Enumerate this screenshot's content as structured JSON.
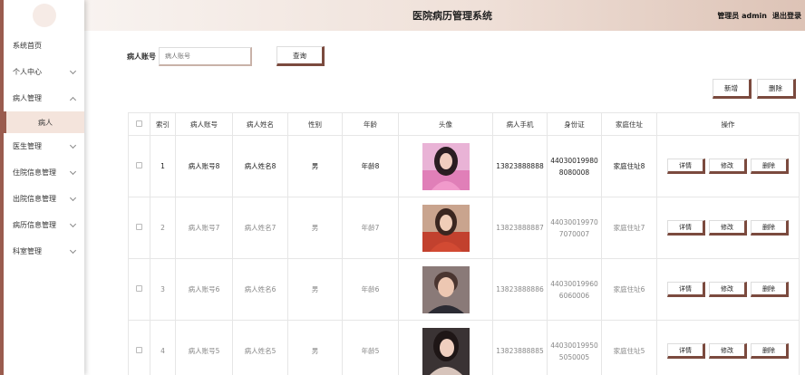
{
  "header": {
    "title": "医院病历管理系统",
    "admin": "管理员 admin",
    "logout": "退出登录"
  },
  "sidebar": {
    "items": [
      {
        "label": "系统首页",
        "chevron": false
      },
      {
        "label": "个人中心",
        "chevron": "down"
      },
      {
        "label": "病人管理",
        "chevron": "up"
      },
      {
        "label": "医生管理",
        "chevron": "down"
      },
      {
        "label": "住院信息管理",
        "chevron": "down"
      },
      {
        "label": "出院信息管理",
        "chevron": "down"
      },
      {
        "label": "病历信息管理",
        "chevron": "down"
      },
      {
        "label": "科室管理",
        "chevron": "down"
      }
    ],
    "sub_item": "病人"
  },
  "search": {
    "label": "病人账号",
    "placeholder": "病人账号",
    "query_label": "查询"
  },
  "actions": {
    "add_label": "新增",
    "delete_label": "删除"
  },
  "table": {
    "headers": [
      "索引",
      "病人账号",
      "病人姓名",
      "性别",
      "年龄",
      "头像",
      "病人手机",
      "身份证",
      "家庭住址",
      "操作"
    ],
    "op_labels": {
      "detail": "详情",
      "edit": "修改",
      "delete": "删除"
    },
    "rows": [
      {
        "index": "1",
        "account": "病人账号8",
        "name": "病人姓名8",
        "gender": "男",
        "age": "年龄8",
        "phone": "13823888888",
        "id_line1": "44030019980",
        "id_line2": "8080008",
        "address": "家庭住址8"
      },
      {
        "index": "2",
        "account": "病人账号7",
        "name": "病人姓名7",
        "gender": "男",
        "age": "年龄7",
        "phone": "13823888887",
        "id_line1": "44030019970",
        "id_line2": "7070007",
        "address": "家庭住址7"
      },
      {
        "index": "3",
        "account": "病人账号6",
        "name": "病人姓名6",
        "gender": "男",
        "age": "年龄6",
        "phone": "13823888886",
        "id_line1": "44030019960",
        "id_line2": "6060006",
        "address": "家庭住址6"
      },
      {
        "index": "4",
        "account": "病人账号5",
        "name": "病人姓名5",
        "gender": "男",
        "age": "年龄5",
        "phone": "13823888885",
        "id_line1": "44030019950",
        "id_line2": "5050005",
        "address": "家庭住址5"
      }
    ]
  },
  "colors": {
    "accent": "#7b4a3e",
    "sidebar_active": "#f4e4dc",
    "header_gradient_end": "#ddc3b6"
  }
}
